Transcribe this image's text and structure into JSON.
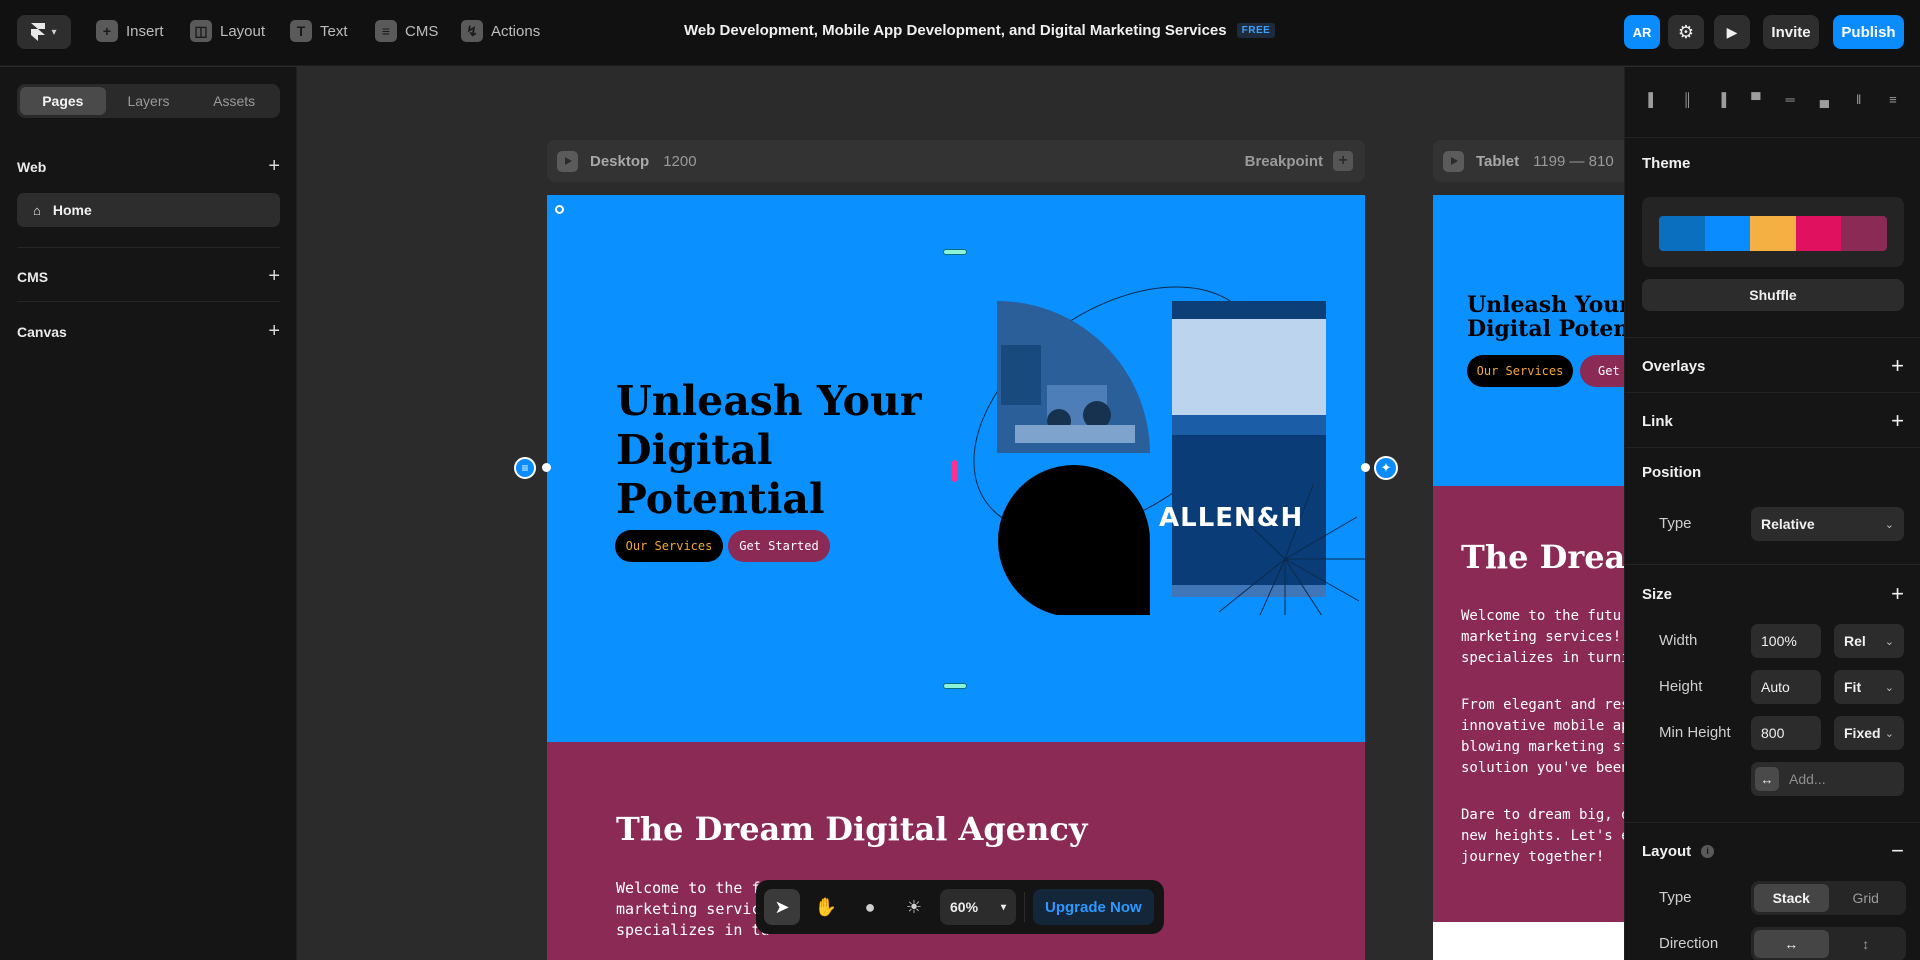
{
  "topbar": {
    "tools": [
      {
        "label": "Insert",
        "icon": "plus-icon"
      },
      {
        "label": "Layout",
        "icon": "layout-icon"
      },
      {
        "label": "Text",
        "icon": "text-icon"
      },
      {
        "label": "CMS",
        "icon": "database-icon"
      },
      {
        "label": "Actions",
        "icon": "lightning-icon"
      }
    ],
    "doc_title": "Web Development, Mobile App Development, and Digital Marketing Services",
    "plan_badge": "FREE",
    "avatar_initials": "AR",
    "invite_label": "Invite",
    "publish_label": "Publish",
    "accent": "#0a8cff"
  },
  "left_panel": {
    "tabs": [
      "Pages",
      "Layers",
      "Assets"
    ],
    "active_tab": "Pages",
    "sections": {
      "web": "Web",
      "cms": "CMS",
      "canvas": "Canvas"
    },
    "pages": [
      {
        "label": "Home",
        "icon": "home-icon"
      }
    ]
  },
  "canvas": {
    "desktop_bar": {
      "name": "Desktop",
      "width": "1200",
      "breakpoint_label": "Breakpoint"
    },
    "tablet_bar": {
      "name": "Tablet",
      "range": "1199 — 810"
    },
    "site": {
      "hero_title_lines": [
        "Unleash Your",
        "Digital",
        "Potential"
      ],
      "btn_services": "Our Services",
      "btn_started": "Get Started",
      "sign_text": "ALLEN&H",
      "section2_title": "The Dream Digital Agency",
      "section2_intro": [
        "Welcome to the fu",
        "marketing service",
        "specializes in tu"
      ],
      "tablet_title_lines": [
        "Unleash Your",
        "Digital Poten"
      ],
      "tablet_btn_services": "Our Services",
      "tablet_btn_started": "Get",
      "tablet_section2_title": "The Dream",
      "tablet_para1": [
        "Welcome to the futu",
        "marketing services!",
        "specializes in turni"
      ],
      "tablet_para2": [
        "From elegant and res",
        "innovative mobile ap",
        "blowing marketing st",
        "solution you've been"
      ],
      "tablet_para3": [
        "Dare to dream big, o",
        "new heights. Let's e",
        "journey together!"
      ],
      "colors": {
        "hero": "#0a90ff",
        "section2": "#8b2a55",
        "btn_dark": "#000000",
        "btn_pink": "#8b2a55",
        "btn_services_text": "#f4a832"
      }
    },
    "floating_toolbar": {
      "zoom": "60%",
      "upgrade_label": "Upgrade Now"
    }
  },
  "right_panel": {
    "theme_title": "Theme",
    "theme_colors": [
      "#0a6fbf",
      "#0a8cff",
      "#f4b042",
      "#e0125f",
      "#8b2a55"
    ],
    "shuffle_label": "Shuffle",
    "overlays_title": "Overlays",
    "link_title": "Link",
    "position_title": "Position",
    "position_type_label": "Type",
    "position_type_value": "Relative",
    "size_title": "Size",
    "width_label": "Width",
    "width_value": "100%",
    "width_unit": "Rel",
    "height_label": "Height",
    "height_value": "Auto",
    "height_unit": "Fit",
    "min_height_label": "Min Height",
    "min_height_value": "800",
    "min_height_unit": "Fixed",
    "add_placeholder": "Add...",
    "layout_title": "Layout",
    "layout_type_label": "Type",
    "layout_type_options": [
      "Stack",
      "Grid"
    ],
    "layout_type_selected": "Stack",
    "direction_label": "Direction"
  }
}
